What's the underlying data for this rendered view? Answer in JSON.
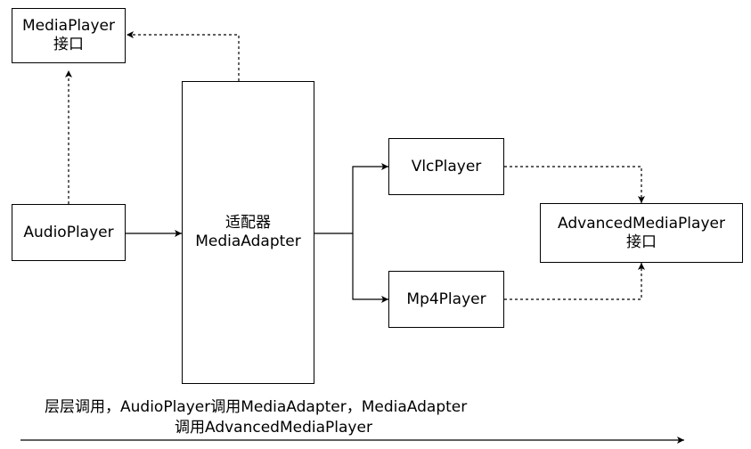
{
  "nodes": {
    "media_player": {
      "line1": "MediaPlayer",
      "line2": "接口"
    },
    "audio_player": {
      "label": "AudioPlayer"
    },
    "media_adapter": {
      "line1": "适配器",
      "line2": "MediaAdapter"
    },
    "vlc_player": {
      "label": "VlcPlayer"
    },
    "mp4_player": {
      "label": "Mp4Player"
    },
    "advanced_media_player": {
      "line1": "AdvancedMediaPlayer",
      "line2": "接口"
    }
  },
  "caption": {
    "line1": "层层调用，AudioPlayer调用MediaAdapter，MediaAdapter",
    "line2": "调用AdvancedMediaPlayer"
  }
}
